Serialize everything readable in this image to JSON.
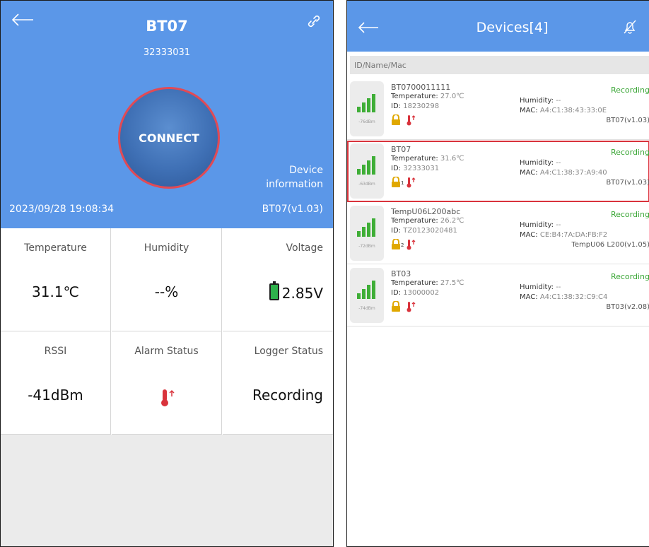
{
  "left": {
    "title": "BT07",
    "subtitle": "32333031",
    "connect_label": "CONNECT",
    "device_info_line1": "Device",
    "device_info_line2": "information",
    "datetime": "2023/09/28  19:08:34",
    "version": "BT07(v1.03)",
    "cells": {
      "temperature_label": "Temperature",
      "temperature_value": "31.1℃",
      "humidity_label": "Humidity",
      "humidity_value": "--%",
      "voltage_label": "Voltage",
      "voltage_value": "2.85V",
      "rssi_label": "RSSI",
      "rssi_value": "-41dBm",
      "alarm_label": "Alarm Status",
      "logger_label": "Logger Status",
      "logger_value": "Recording"
    }
  },
  "right": {
    "title": "Devices[4]",
    "search_placeholder": "ID/Name/Mac",
    "labels": {
      "temperature": "Temperature",
      "id": "ID",
      "humidity": "Humidity",
      "mac": "MAC"
    },
    "devices": [
      {
        "name": "BT0700011111",
        "temperature": "27.0℃",
        "id": "18230298",
        "humidity": "--",
        "mac": "A4:C1:38:43:33:0E",
        "status": "Recording",
        "version": "BT07(v1.03)",
        "dbm": "-76dBm",
        "lock_num": ""
      },
      {
        "name": "BT07",
        "temperature": "31.6℃",
        "id": "32333031",
        "humidity": "--",
        "mac": "A4:C1:38:37:A9:40",
        "status": "Recording",
        "version": "BT07(v1.03)",
        "dbm": "-63dBm",
        "lock_num": "1"
      },
      {
        "name": "TempU06L200abc",
        "temperature": "26.2℃",
        "id": "TZ0123020481",
        "humidity": "--",
        "mac": "CE:B4:7A:DA:FB:F2",
        "status": "Recording",
        "version": "TempU06 L200(v1.05)",
        "dbm": "-72dBm",
        "lock_num": "2"
      },
      {
        "name": "BT03",
        "temperature": "27.5℃",
        "id": "13000002",
        "humidity": "--",
        "mac": "A4:C1:38:32:C9:C4",
        "status": "Recording",
        "version": "BT03(v2.08)",
        "dbm": "-74dBm",
        "lock_num": ""
      }
    ]
  },
  "colors": {
    "header_blue": "#5b97e8",
    "connect_ring": "#e14a55",
    "recording_green": "#3aa636",
    "selected_outline": "#d9333c",
    "alarm_red": "#d9333c"
  },
  "icons": [
    "back-arrow-icon",
    "link-icon",
    "battery-icon",
    "thermometer-alarm-icon",
    "bell-off-icon",
    "signal-bars-icon",
    "lock-icon"
  ]
}
